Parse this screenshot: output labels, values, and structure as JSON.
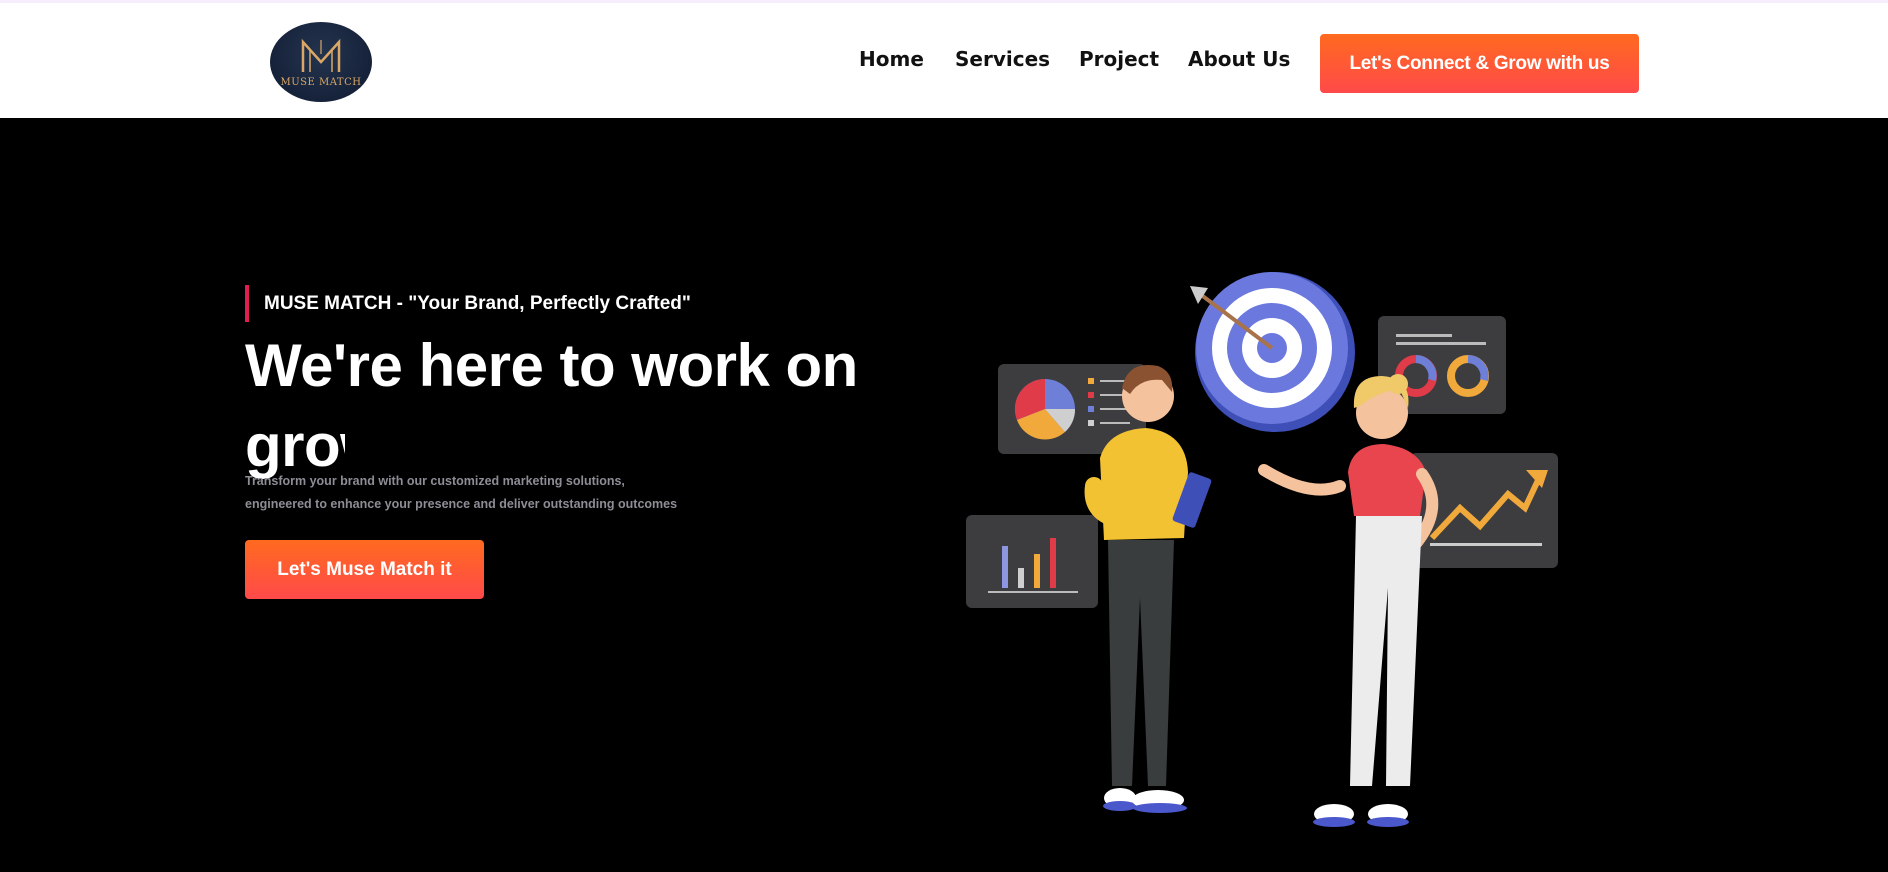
{
  "header": {
    "logo_text": "MUSE MATCH",
    "nav": [
      {
        "label": "Home"
      },
      {
        "label": "Services"
      },
      {
        "label": "Project"
      },
      {
        "label": "About Us"
      }
    ],
    "cta_label": "Let's Connect & Grow with us"
  },
  "hero": {
    "tagline": "MUSE MATCH - \"Your Brand, Perfectly Crafted\"",
    "headline_line1": "We're here to work on",
    "headline_line2": "grow",
    "description_line1": "Transform your brand with our customized marketing solutions,",
    "description_line2": "engineered to enhance your presence and deliver outstanding outcomes",
    "cta_label": "Let's Muse Match it"
  },
  "colors": {
    "accent_gradient_start": "#ff6a1f",
    "accent_gradient_end": "#ff4a4a",
    "tag_bar": "#e21d52",
    "hero_bg": "#000000",
    "header_bg": "#ffffff"
  },
  "icons": {
    "logo": "muse-match-monogram",
    "illustration": "marketing-team-target-illustration"
  }
}
